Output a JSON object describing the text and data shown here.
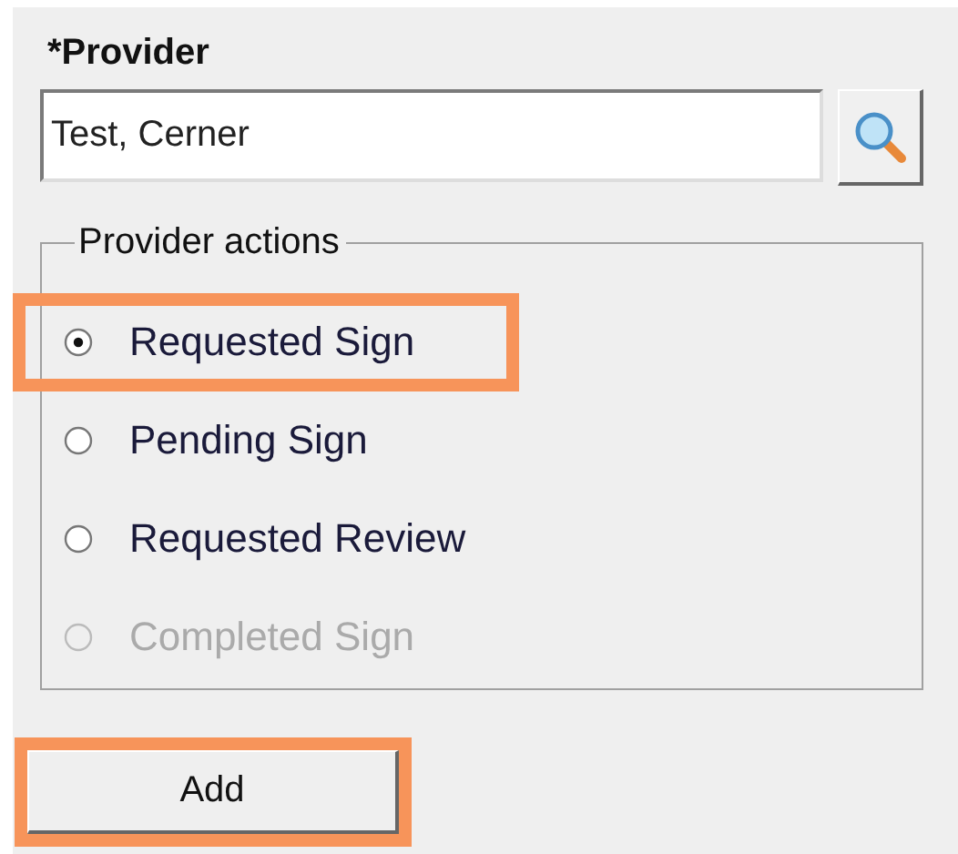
{
  "provider": {
    "label": "*Provider",
    "value": "Test, Cerner"
  },
  "actions": {
    "legend": "Provider actions",
    "options": [
      {
        "label": "Requested Sign",
        "selected": true,
        "disabled": false,
        "highlighted": true
      },
      {
        "label": "Pending Sign",
        "selected": false,
        "disabled": false,
        "highlighted": false
      },
      {
        "label": "Requested Review",
        "selected": false,
        "disabled": false,
        "highlighted": false
      },
      {
        "label": "Completed Sign",
        "selected": false,
        "disabled": true,
        "highlighted": false
      }
    ]
  },
  "add_button": {
    "label": "Add",
    "highlighted": true
  }
}
